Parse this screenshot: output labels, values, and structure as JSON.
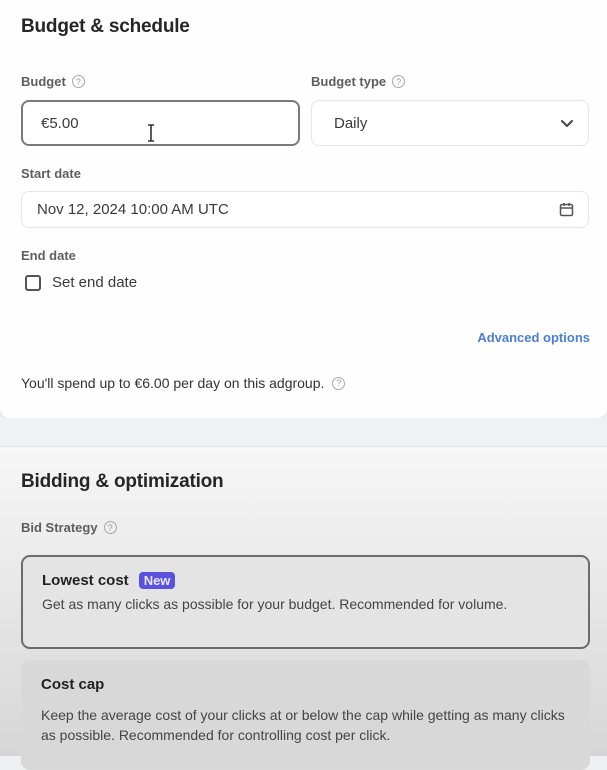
{
  "budget_schedule": {
    "title": "Budget & schedule",
    "budget_label": "Budget",
    "budget_value": "€5.00",
    "budget_type_label": "Budget type",
    "budget_type_value": "Daily",
    "start_date_label": "Start date",
    "start_date_value": "Nov 12, 2024 10:00 AM UTC",
    "end_date_label": "End date",
    "set_end_date_label": "Set end date",
    "set_end_date_checked": false,
    "advanced_options_label": "Advanced options",
    "summary_text": "You'll spend up to €6.00 per day on this adgroup.",
    "help_glyph": "?"
  },
  "bidding": {
    "title": "Bidding & optimization",
    "bid_strategy_label": "Bid Strategy",
    "options": [
      {
        "title": "Lowest cost",
        "badge": "New",
        "description": "Get as many clicks as possible for your budget. Recommended for volume.",
        "selected": true
      },
      {
        "title": "Cost cap",
        "description": "Keep the average cost of your clicks at or below the cap while getting as many clicks as possible. Recommended for controlling cost per click.",
        "selected": false
      }
    ]
  },
  "colors": {
    "badge": "#5a52de",
    "link": "#4a7fd4"
  },
  "icons": {
    "cursor": "text-cursor-icon",
    "calendar": "calendar-icon",
    "chevron": "chevron-down-icon",
    "help": "help-circle-icon"
  }
}
